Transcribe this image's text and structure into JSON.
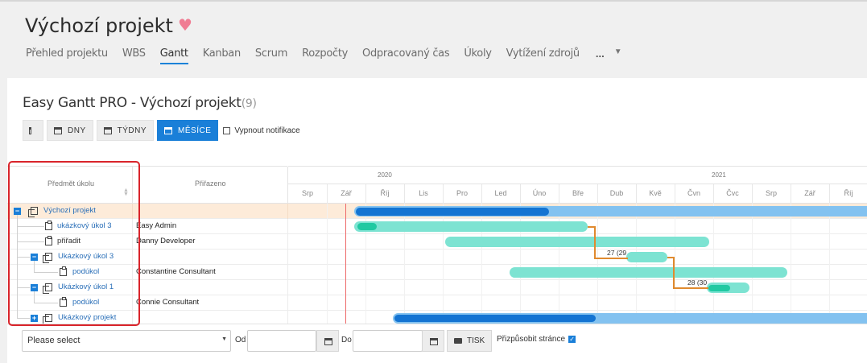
{
  "project": {
    "title": "Výchozí projekt",
    "tabs": [
      "Přehled projektu",
      "WBS",
      "Gantt",
      "Kanban",
      "Scrum",
      "Rozpočty",
      "Odpracovaný čas",
      "Úkoly",
      "Vytížení zdrojů"
    ],
    "active_tab": "Gantt",
    "more": "..."
  },
  "gantt": {
    "title": "Easy Gantt PRO - Výchozí projekt",
    "count": "(9)",
    "buttons": {
      "days": "DNY",
      "weeks": "TÝDNY",
      "months": "MĚSÍCE"
    },
    "notifications_label": "Vypnout notifikace",
    "columns": {
      "subject": "Předmět úkolu",
      "assignee": "Přiřazeno"
    },
    "years": [
      "2020",
      "2021"
    ],
    "months": [
      "Srp",
      "Zář",
      "Říj",
      "Lis",
      "Pro",
      "Led",
      "Úno",
      "Bře",
      "Dub",
      "Kvě",
      "Čvn",
      "Čvc",
      "Srp",
      "Zář",
      "Říj"
    ],
    "rows": [
      {
        "label": "Výchozí projekt",
        "assignee": ""
      },
      {
        "label": "ukázkový úkol 3",
        "assignee": "Easy Admin"
      },
      {
        "label": "přiřadit",
        "assignee": "Danny Developer"
      },
      {
        "label": "Ukázkový úkol 3",
        "assignee": ""
      },
      {
        "label": "podúkol",
        "assignee": "Constantine Consultant"
      },
      {
        "label": "Ukázkový úkol 1",
        "assignee": ""
      },
      {
        "label": "podúkol",
        "assignee": "Connie Consultant"
      },
      {
        "label": "Ukázkový projekt",
        "assignee": ""
      }
    ],
    "dep_labels": [
      "27 (29",
      "28 (30"
    ]
  },
  "footer": {
    "select_placeholder": "Please select",
    "from_label": "Od",
    "to_label": "Do",
    "print_label": "TISK",
    "fit_label": "Přizpůsobit stránce"
  },
  "colors": {
    "accent": "#1a7fd8",
    "project_bar": "#83c2f0",
    "progress_bar": "#1474d2",
    "task_bar": "#7de3d2",
    "today_line": "#ee6a6a",
    "highlight": "#d9242b"
  }
}
